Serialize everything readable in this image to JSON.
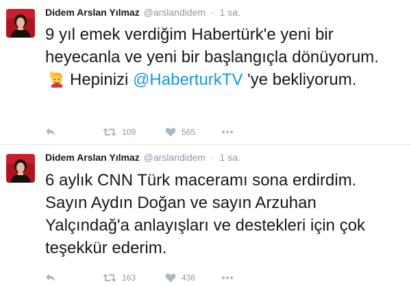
{
  "tweets": [
    {
      "name": "Didem Arslan Yılmaz",
      "handle": "@arslandidem",
      "separator": "·",
      "time": "1 sa.",
      "text_before": "9 yıl emek verdiğim Habertürk'e yeni bir heyecanla ve yeni bir başlangıçla dönüyorum.",
      "emoji": "raising-hand-emoji",
      "text_mid": "Hepinizi ",
      "mention": "@HaberturkTV",
      "text_after": " 'ye bekliyorum.",
      "retweets": "109",
      "likes": "565"
    },
    {
      "name": "Didem Arslan Yılmaz",
      "handle": "@arslandidem",
      "separator": "·",
      "time": "1 sa.",
      "text": "6 aylık CNN Türk maceramı sona erdirdim. Sayın Aydın Doğan ve sayın Arzuhan Yalçındağ'a anlayışları ve destekleri için çok teşekkür ederim.",
      "retweets": "163",
      "likes": "436"
    }
  ],
  "colors": {
    "text": "#14171a",
    "muted": "#8899a6",
    "icon": "#aab8c2",
    "link": "#1b95e0",
    "divider": "#e1e8ed",
    "avatar_bg": "#b01420"
  },
  "icons": [
    "reply-icon",
    "retweet-icon",
    "like-icon",
    "more-icon"
  ]
}
